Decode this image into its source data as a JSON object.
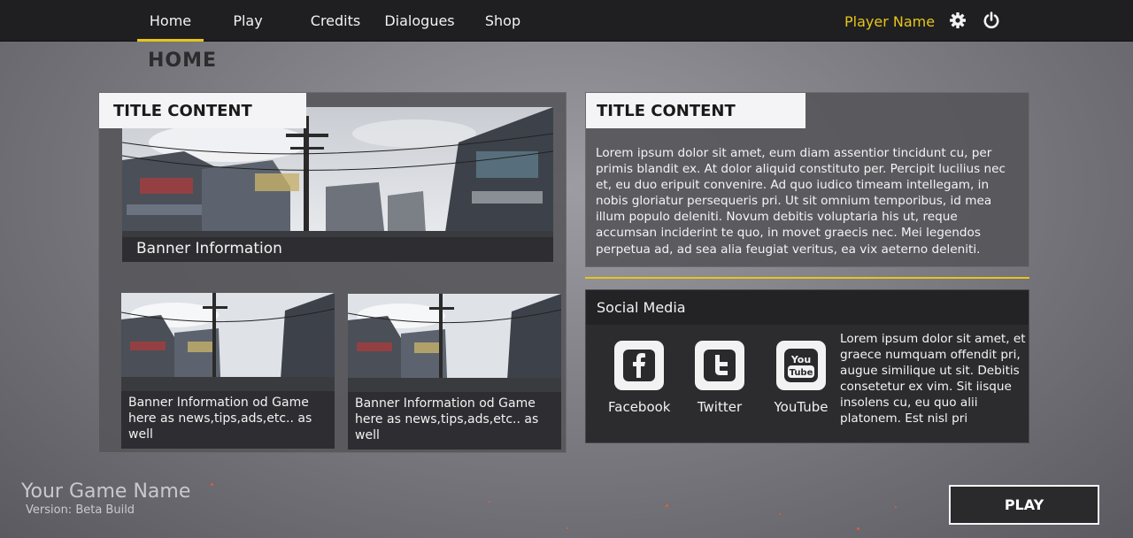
{
  "nav": {
    "items": [
      {
        "label": "Home"
      },
      {
        "label": "Play"
      },
      {
        "label": "Credits"
      },
      {
        "label": "Dialogues"
      },
      {
        "label": "Shop"
      }
    ],
    "active": "Home",
    "player_name": "Player Name"
  },
  "page_title": "HOME",
  "left_panel": {
    "title": "TITLE CONTENT",
    "main_banner_caption": "Banner Information",
    "small_banners": [
      {
        "caption": "Banner Information od Game here as news,tips,ads,etc.. as well"
      },
      {
        "caption": "Banner Information od Game here as news,tips,ads,etc.. as well"
      }
    ]
  },
  "right_panel": {
    "title": "TITLE CONTENT",
    "body": "Lorem ipsum dolor sit amet, eum diam assentior tincidunt cu, per primis blandit ex. At dolor aliquid constituto per. Percipit lucilius nec et, eu duo eripuit convenire. Ad quo iudico timeam intellegam, in nobis gloriatur persequeris pri. Ut sit omnium temporibus, id mea illum populo deleniti. Novum debitis voluptaria his ut, reque accumsan inciderint te quo, in movet graecis nec. Mei legendos perpetua ad, ad sea alia feugiat veritus, ea vix aeterno deleniti."
  },
  "social": {
    "heading": "Social Media",
    "links": [
      {
        "label": "Facebook",
        "icon": "facebook-icon"
      },
      {
        "label": "Twitter",
        "icon": "twitter-icon"
      },
      {
        "label": "YouTube",
        "icon": "youtube-icon"
      }
    ],
    "youtube_logo_text": {
      "line1": "You",
      "line2": "Tube"
    },
    "text": "Lorem ipsum dolor sit amet, et graece numquam offendit pri, augue similique ut sit. Debitis consetetur ex vim. Sit iisque insolens cu, eu quo alii platonem. Est nisl pri"
  },
  "footer": {
    "game_name": "Your Game Name",
    "version": "Version: Beta Build",
    "play_label": "PLAY"
  },
  "colors": {
    "accent": "#e6c51a",
    "topbar": "#1f1f21",
    "panel": "#55555a"
  }
}
